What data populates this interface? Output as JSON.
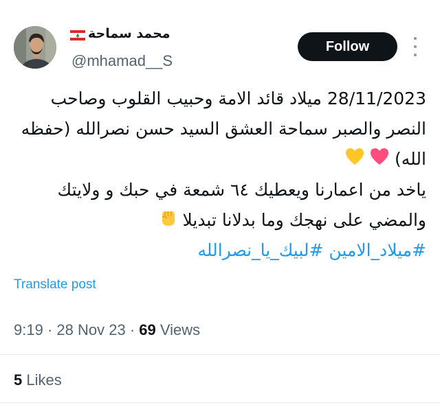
{
  "header": {
    "display_name": "محمد سماحة",
    "flag_icon": "lebanon-flag-icon",
    "handle": "@mhamad__S",
    "follow_label": "Follow",
    "more_icon": "more-vertical-icon"
  },
  "post": {
    "lines": [
      "28/11/2023 ميلاد قائد الامة وحبيب القلوب وصاحب",
      "النصر والصبر سماحة العشق السيد حسن نصرالله (حفظه",
      "الله)",
      "ياخد من اعمارنا ويعطيك ٦٤ شمعة في حبك و ولايتك",
      "والمضي على نهجك وما بدلانا تبديلا"
    ],
    "emojis": [
      "pink-heart-icon",
      "yellow-heart-icon",
      "raised-fist-icon"
    ],
    "hashtags": [
      "#ميلاد_الامين",
      "#لبيك_يا_نصرالله"
    ]
  },
  "translate_label": "Translate post",
  "meta": {
    "time": "9:19",
    "separator": "·",
    "date": "28 Nov 23",
    "views_count": "69",
    "views_label": "Views"
  },
  "likes": {
    "count": "5",
    "label": "Likes"
  },
  "colors": {
    "accent": "#1d9bf0",
    "text": "#0f1419",
    "secondary": "#536471",
    "button": "#0f1419"
  }
}
